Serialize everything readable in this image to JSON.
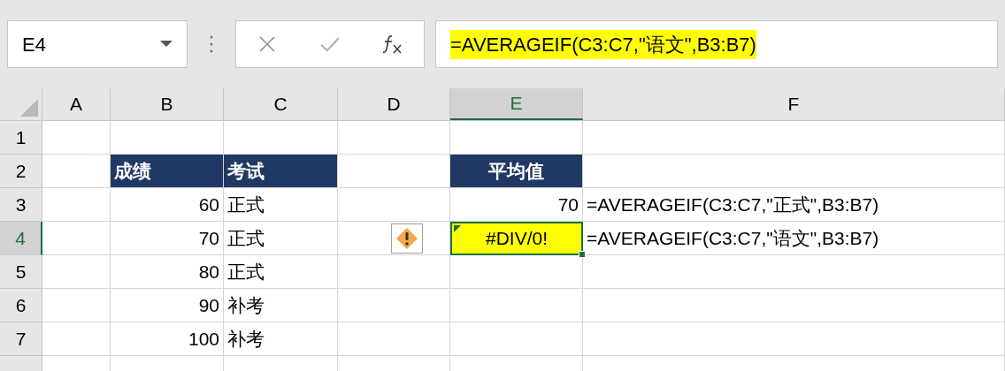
{
  "name_box": {
    "value": "E4"
  },
  "formula_bar": {
    "value": "=AVERAGEIF(C3:C7,\"语文\",B3:B7)",
    "highlighted": true
  },
  "columns": [
    {
      "label": "A",
      "selected": false
    },
    {
      "label": "B",
      "selected": false
    },
    {
      "label": "C",
      "selected": false
    },
    {
      "label": "D",
      "selected": false
    },
    {
      "label": "E",
      "selected": true
    },
    {
      "label": "F",
      "selected": false
    }
  ],
  "rows": [
    {
      "label": "1",
      "selected": false,
      "cells": [
        {
          "kind": "empty"
        },
        {
          "kind": "empty"
        },
        {
          "kind": "empty"
        },
        {
          "kind": "empty"
        },
        {
          "kind": "empty"
        },
        {
          "kind": "empty"
        }
      ]
    },
    {
      "label": "2",
      "selected": false,
      "cells": [
        {
          "kind": "empty"
        },
        {
          "kind": "header",
          "text": "成绩"
        },
        {
          "kind": "header",
          "text": "考试"
        },
        {
          "kind": "empty"
        },
        {
          "kind": "header_center",
          "text": "平均值"
        },
        {
          "kind": "empty"
        }
      ]
    },
    {
      "label": "3",
      "selected": false,
      "cells": [
        {
          "kind": "empty"
        },
        {
          "kind": "number",
          "text": "60"
        },
        {
          "kind": "text",
          "text": "正式"
        },
        {
          "kind": "empty"
        },
        {
          "kind": "number",
          "text": "70"
        },
        {
          "kind": "text",
          "text": "=AVERAGEIF(C3:C7,\"正式\",B3:B7)"
        }
      ]
    },
    {
      "label": "4",
      "selected": true,
      "cells": [
        {
          "kind": "empty"
        },
        {
          "kind": "number",
          "text": "70"
        },
        {
          "kind": "text",
          "text": "正式"
        },
        {
          "kind": "warning"
        },
        {
          "kind": "error",
          "text": "#DIV/0!",
          "selected": true,
          "highlighted": true
        },
        {
          "kind": "text",
          "text": "=AVERAGEIF(C3:C7,\"语文\",B3:B7)"
        }
      ]
    },
    {
      "label": "5",
      "selected": false,
      "cells": [
        {
          "kind": "empty"
        },
        {
          "kind": "number",
          "text": "80"
        },
        {
          "kind": "text",
          "text": "正式"
        },
        {
          "kind": "empty"
        },
        {
          "kind": "empty"
        },
        {
          "kind": "empty"
        }
      ]
    },
    {
      "label": "6",
      "selected": false,
      "cells": [
        {
          "kind": "empty"
        },
        {
          "kind": "number",
          "text": "90"
        },
        {
          "kind": "text",
          "text": "补考"
        },
        {
          "kind": "empty"
        },
        {
          "kind": "empty"
        },
        {
          "kind": "empty"
        }
      ]
    },
    {
      "label": "7",
      "selected": false,
      "cells": [
        {
          "kind": "empty"
        },
        {
          "kind": "number",
          "text": "100"
        },
        {
          "kind": "text",
          "text": "补考"
        },
        {
          "kind": "empty"
        },
        {
          "kind": "empty"
        },
        {
          "kind": "empty"
        }
      ]
    }
  ]
}
